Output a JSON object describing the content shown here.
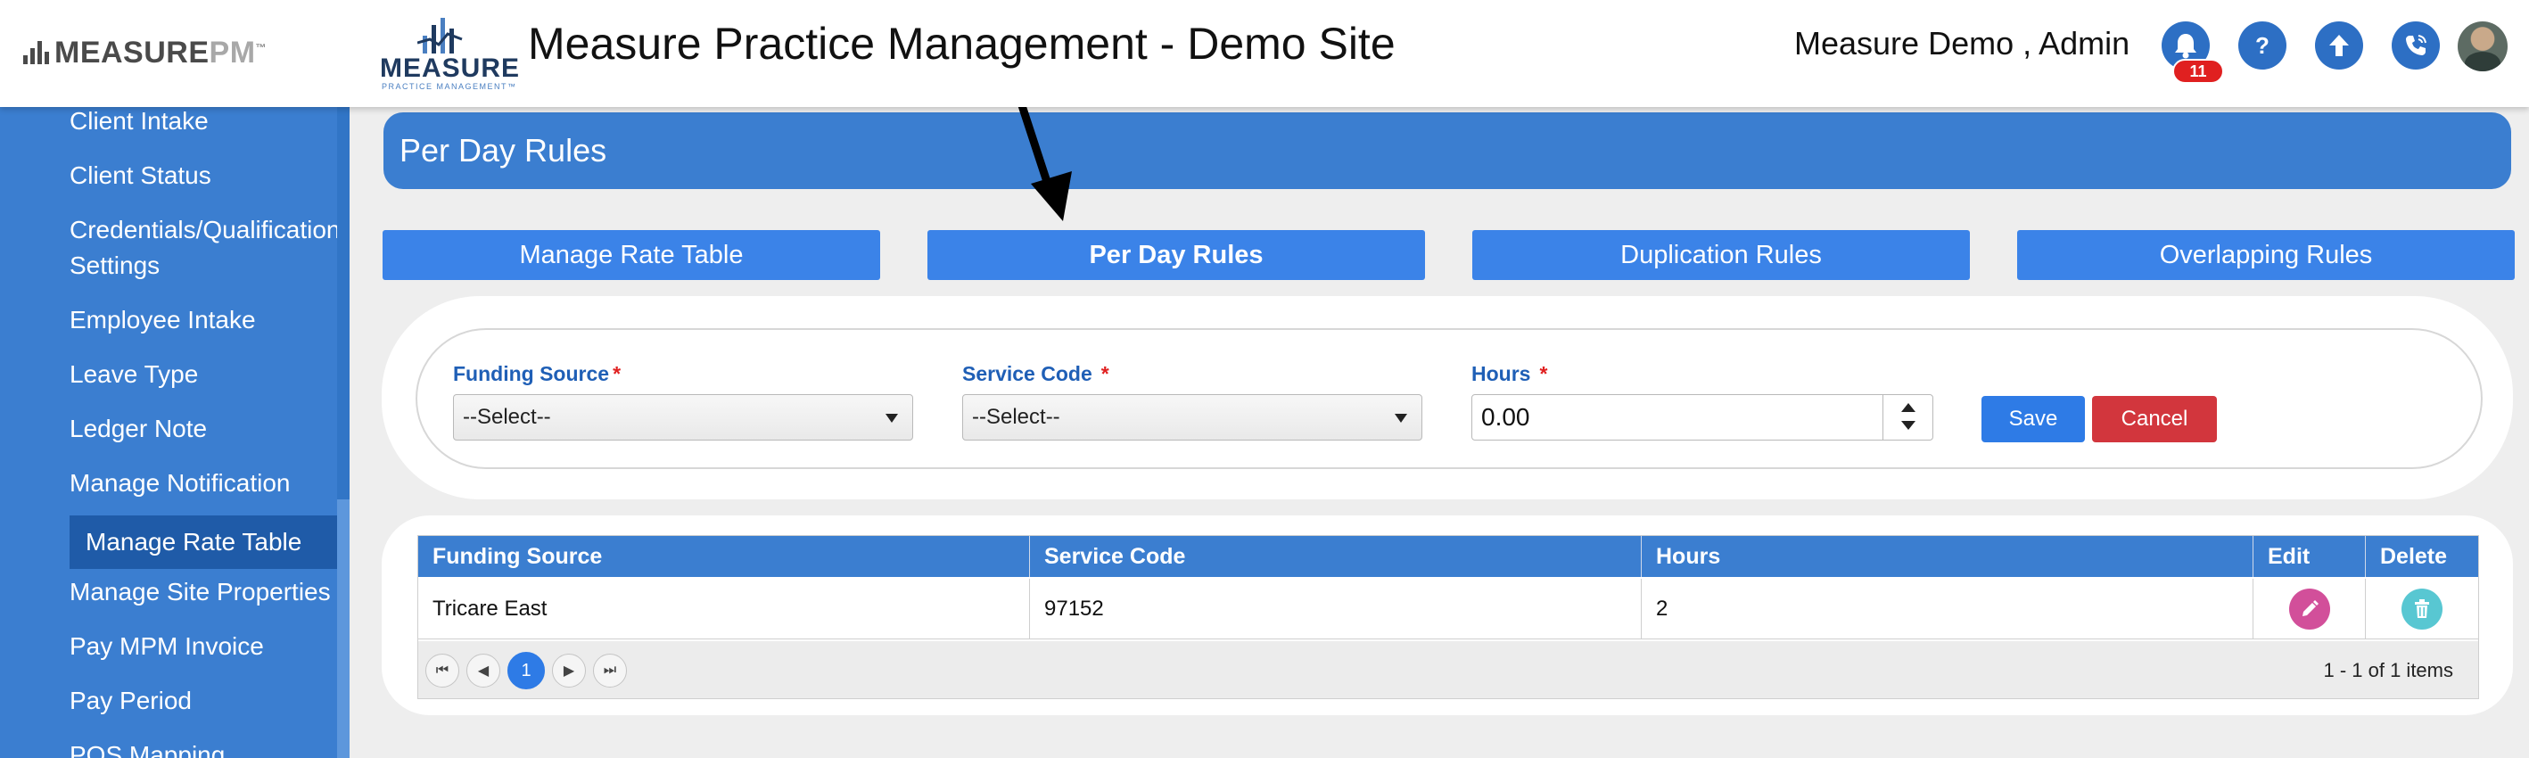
{
  "header": {
    "brand_measure": "MEASURE",
    "brand_pm": "PM",
    "brand_tm": "™",
    "logo_word": "MEASURE",
    "logo_sub": "PRACTICE MANAGEMENT™",
    "app_title": "Measure Practice Management - Demo Site",
    "user_name": "Measure Demo , Admin",
    "notification_count": "11",
    "help_glyph": "?",
    "icons": [
      "bell-icon",
      "help-icon",
      "upload-icon",
      "phone-icon",
      "avatar"
    ]
  },
  "sidebar": {
    "items": [
      {
        "label": "Client Intake"
      },
      {
        "label": "Client Status"
      },
      {
        "label": "Credentials/Qualification"
      },
      {
        "label": "Settings"
      },
      {
        "label": "Employee Intake"
      },
      {
        "label": "Leave Type"
      },
      {
        "label": "Ledger Note"
      },
      {
        "label": "Manage Notification"
      },
      {
        "label": "Manage Rate Table"
      },
      {
        "label": "Manage Site Properties"
      },
      {
        "label": "Pay MPM Invoice"
      },
      {
        "label": "Pay Period"
      },
      {
        "label": "POS Mapping"
      }
    ],
    "active": "Manage Rate Table"
  },
  "page": {
    "title": "Per Day Rules",
    "tabs": [
      {
        "label": "Manage Rate Table"
      },
      {
        "label": "Per Day Rules"
      },
      {
        "label": "Duplication Rules"
      },
      {
        "label": "Overlapping Rules"
      }
    ],
    "active_tab": "Per Day Rules"
  },
  "form": {
    "funding_source_label": "Funding Source",
    "service_code_label": "Service Code",
    "hours_label": "Hours",
    "required_mark": "*",
    "funding_source_value": "--Select--",
    "service_code_value": "--Select--",
    "hours_value": "0.00",
    "save_label": "Save",
    "cancel_label": "Cancel"
  },
  "grid": {
    "columns": [
      "Funding Source",
      "Service Code",
      "Hours",
      "Edit",
      "Delete"
    ],
    "rows": [
      {
        "funding_source": "Tricare East",
        "service_code": "97152",
        "hours": "2"
      }
    ],
    "pager": {
      "current_page": "1",
      "first": "⏮",
      "prev": "◀",
      "next": "▶",
      "last": "⏭",
      "info": "1 - 1 of 1 items"
    }
  },
  "colors": {
    "primary": "#3b7ed0",
    "tab_button": "#3b83e8",
    "save": "#2e7be6",
    "cancel": "#d2363d",
    "edit_icon": "#d24f9a",
    "delete_icon": "#58c7d2",
    "badge": "#e02020"
  }
}
